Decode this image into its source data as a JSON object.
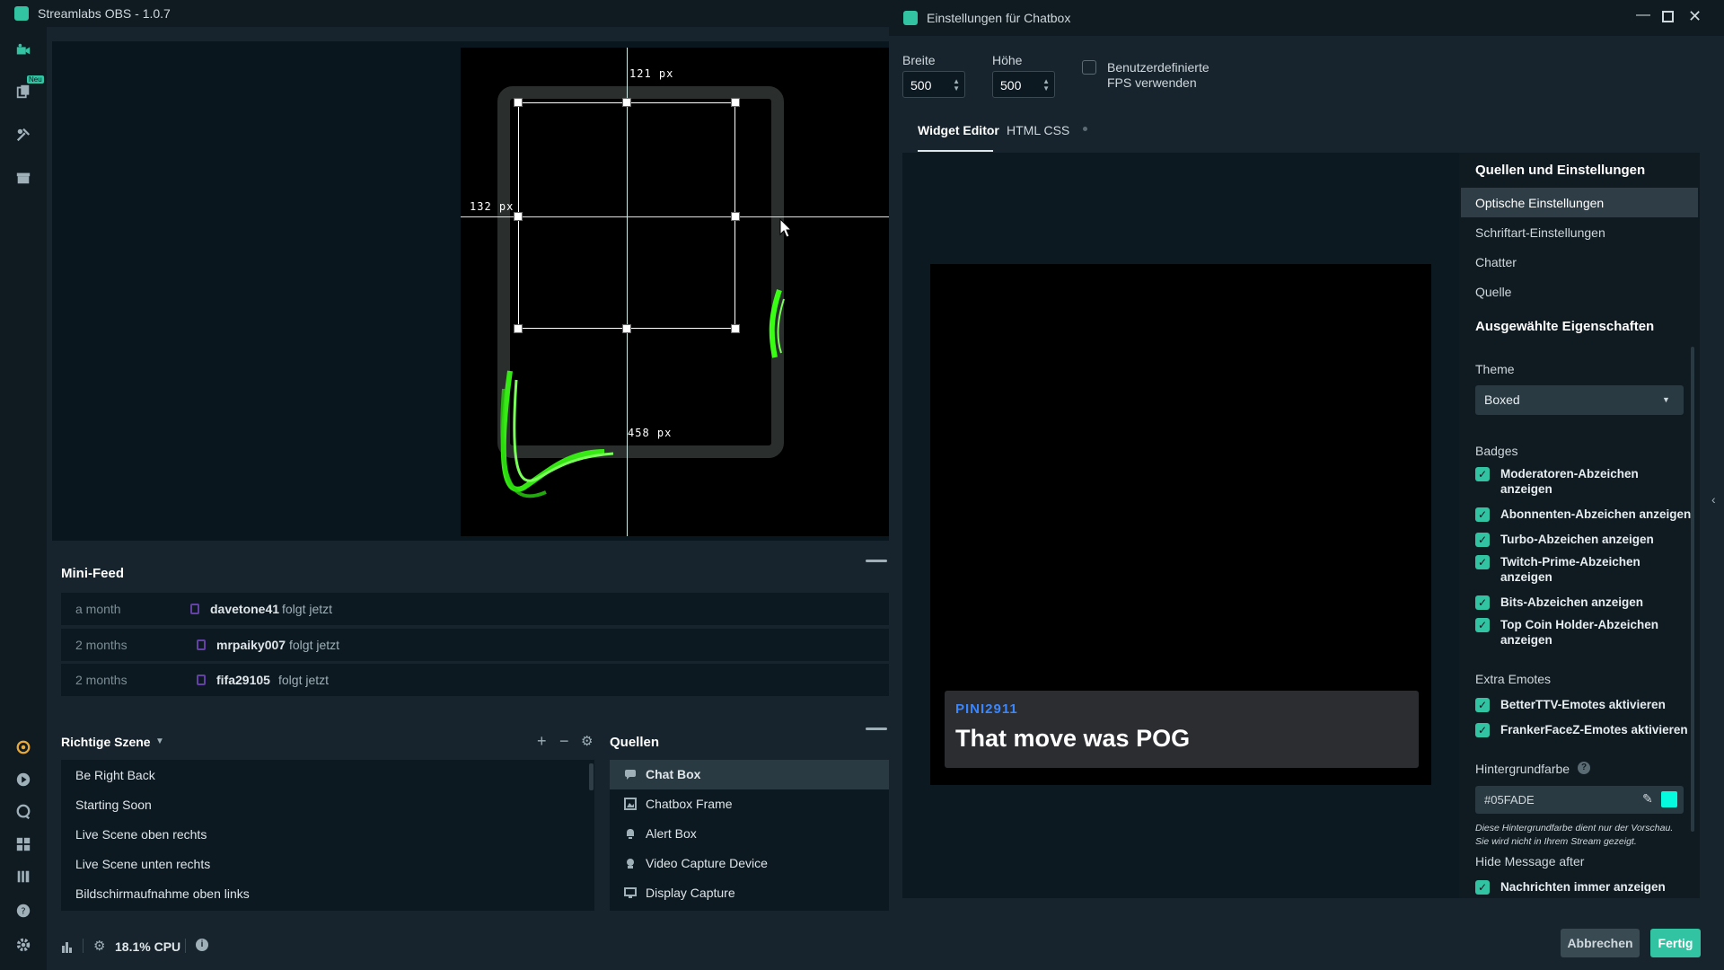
{
  "app": {
    "title": "Streamlabs OBS - 1.0.7",
    "new_badge": "Neu"
  },
  "canvas": {
    "top_distance": "121 px",
    "left_distance": "132 px",
    "bottom_distance": "458 px"
  },
  "minifeed": {
    "title": "Mini-Feed",
    "rows": [
      {
        "time": "a month",
        "user": "davetone41",
        "action": "folgt jetzt"
      },
      {
        "time": "2 months",
        "user": "mrpaiky007",
        "action": "folgt jetzt"
      },
      {
        "time": "2 months",
        "user": "fifa29105",
        "action": "folgt jetzt"
      }
    ]
  },
  "scenes": {
    "title": "Richtige Szene",
    "items": [
      "Be Right Back",
      "Starting Soon",
      "Live Scene oben rechts",
      "Live Scene unten rechts",
      "Bildschirmaufnahme oben links"
    ]
  },
  "sources": {
    "title": "Quellen",
    "items": [
      {
        "label": "Chat Box",
        "icon": "chat-icon"
      },
      {
        "label": "Chatbox Frame",
        "icon": "image-icon"
      },
      {
        "label": "Alert Box",
        "icon": "bell-icon"
      },
      {
        "label": "Video Capture Device",
        "icon": "camera-icon"
      },
      {
        "label": "Display Capture",
        "icon": "monitor-icon"
      }
    ]
  },
  "status": {
    "cpu": "18.1% CPU"
  },
  "dialog": {
    "title": "Einstellungen für Chatbox",
    "width_label": "Breite",
    "width_value": "500",
    "height_label": "Höhe",
    "height_value": "500",
    "fps_label_line1": "Benutzerdefinierte",
    "fps_label_line2": "FPS verwenden",
    "tabs": [
      "Widget Editor",
      "HTML CSS"
    ],
    "preview": {
      "username": "PINI2911",
      "message": "That move was POG",
      "username_color": "#3a86ff"
    },
    "menu_title": "Quellen und Einstellungen",
    "menu": [
      "Optische Einstellungen",
      "Schriftart-Einstellungen",
      "Chatter",
      "Quelle"
    ],
    "props_title": "Ausgewählte Eigenschaften",
    "theme_label": "Theme",
    "theme_value": "Boxed",
    "badges_label": "Badges",
    "badges": [
      {
        "l1": "Moderatoren-Abzeichen",
        "l2": "anzeigen"
      },
      {
        "l1": "Abonnenten-Abzeichen anzeigen",
        "l2": ""
      },
      {
        "l1": "Turbo-Abzeichen anzeigen",
        "l2": ""
      },
      {
        "l1": "Twitch-Prime-Abzeichen",
        "l2": "anzeigen"
      },
      {
        "l1": "Bits-Abzeichen anzeigen",
        "l2": ""
      },
      {
        "l1": "Top Coin Holder-Abzeichen",
        "l2": "anzeigen"
      }
    ],
    "emotes_label": "Extra Emotes",
    "emotes": [
      "BetterTTV-Emotes aktivieren",
      "FrankerFaceZ-Emotes aktivieren"
    ],
    "bg_label": "Hintergrundfarbe",
    "bg_value": "#05FADE",
    "bg_note_1": "Diese Hintergrundfarbe dient nur der Vorschau.",
    "bg_note_2": "Sie wird nicht in Ihrem Stream gezeigt.",
    "hide_label": "Hide Message after",
    "always_label": "Nachrichten immer anzeigen",
    "cancel": "Abbrechen",
    "done": "Fertig"
  },
  "colors": {
    "accent": "#31c3a2",
    "swatch": "#05FADE",
    "neon": "#39ff14"
  }
}
